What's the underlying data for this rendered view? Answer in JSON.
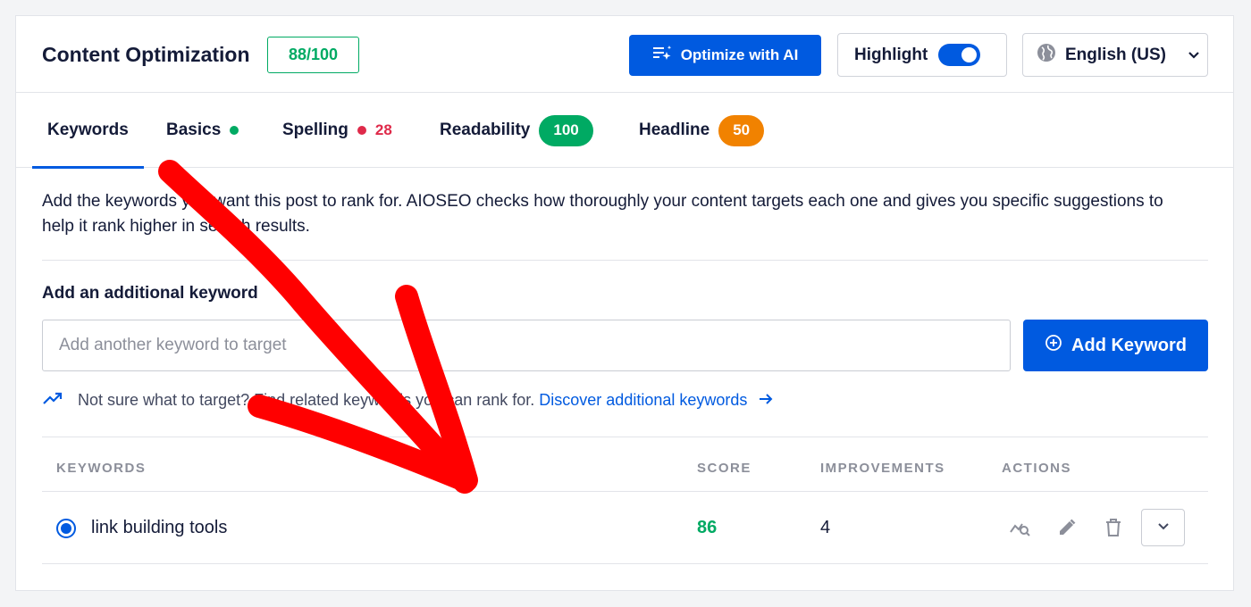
{
  "header": {
    "title": "Content Optimization",
    "score": "88/100",
    "ai_button_label": "Optimize with AI",
    "highlight_label": "Highlight",
    "highlight_on": true,
    "language": "English (US)"
  },
  "tabs": [
    {
      "label": "Keywords",
      "active": true
    },
    {
      "label": "Basics",
      "status": "green"
    },
    {
      "label": "Spelling",
      "status": "red",
      "count": "28"
    },
    {
      "label": "Readability",
      "badge": "100",
      "badge_color": "#00aa63"
    },
    {
      "label": "Headline",
      "badge": "50",
      "badge_color": "#f18200"
    }
  ],
  "keywords_panel": {
    "description": "Add the keywords you want this post to rank for. AIOSEO checks how thoroughly your content targets each one and gives you specific suggestions to help it rank higher in search results.",
    "add_label": "Add an additional keyword",
    "input_value": "",
    "input_placeholder": "Add another keyword to target",
    "add_button_label": "Add Keyword",
    "hint_text": "Not sure what to target? Find related keywords you can rank for.",
    "hint_link": "Discover additional keywords"
  },
  "table": {
    "headers": [
      "KEYWORDS",
      "SCORE",
      "IMPROVEMENTS",
      "ACTIONS"
    ],
    "rows": [
      {
        "keyword": "link building tools",
        "score": "86",
        "improvements": "4",
        "selected": true
      }
    ]
  },
  "colors": {
    "primary": "#005ae0",
    "success": "#00aa63",
    "warning": "#f18200",
    "danger": "#df2a4a",
    "annotation_arrow": "#ff0000"
  },
  "icons": [
    "ai-sparkle-list-icon",
    "globe-icon",
    "chevron-down-icon",
    "plus-circle-icon",
    "trending-up-icon",
    "arrow-right-icon",
    "keyword-analysis-icon",
    "pencil-icon",
    "trash-icon"
  ]
}
